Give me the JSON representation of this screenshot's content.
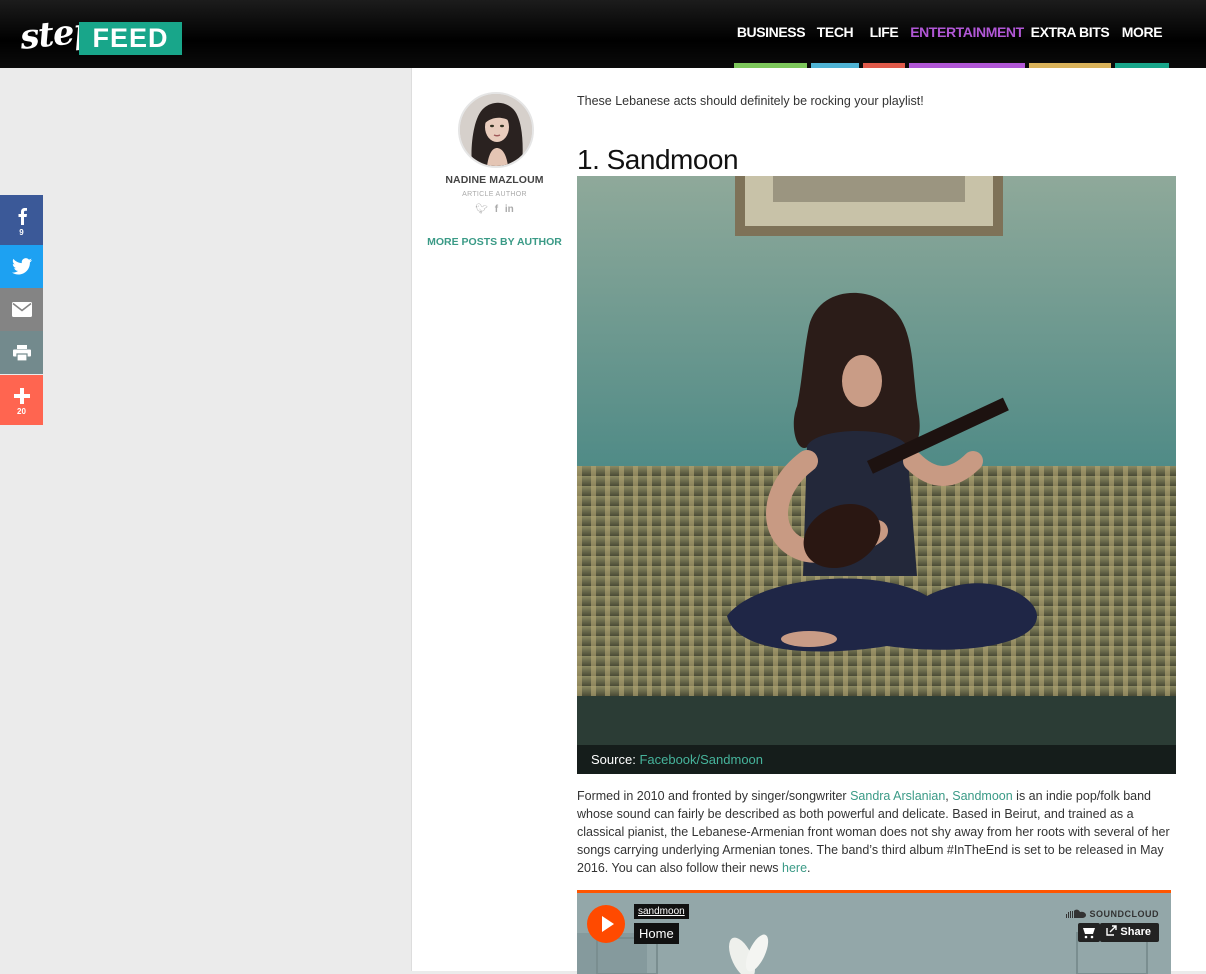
{
  "logo": {
    "step": "step",
    "feed": "FEED"
  },
  "nav": {
    "items": [
      {
        "label": "BUSINESS",
        "color": "#7dc75b"
      },
      {
        "label": "TECH",
        "color": "#4fb3d4"
      },
      {
        "label": "LIFE",
        "color": "#e05a4a"
      },
      {
        "label": "ENTERTAINMENT",
        "color": "#b157d6",
        "active": true
      },
      {
        "label": "EXTRA BITS",
        "color": "#d9b25a"
      },
      {
        "label": "MORE",
        "color": "#18a68a"
      }
    ]
  },
  "share": {
    "facebook": {
      "icon": "facebook-icon",
      "count": "9",
      "color": "#3b5998"
    },
    "twitter": {
      "icon": "twitter-icon",
      "color": "#1da1f2"
    },
    "email": {
      "icon": "email-icon",
      "color": "#848484"
    },
    "print": {
      "icon": "print-icon",
      "color": "#738a8d"
    },
    "more": {
      "icon": "plus-icon",
      "count": "20",
      "color": "#ff6550"
    }
  },
  "author": {
    "name": "NADINE MAZLOUM",
    "role": "ARTICLE AUTHOR",
    "more_posts": "MORE POSTS BY AUTHOR"
  },
  "article": {
    "intro": "These Lebanese acts should definitely be rocking your playlist!",
    "section_title": "1. Sandmoon",
    "caption_label": "Source:",
    "caption_link": "Facebook/Sandmoon",
    "body": {
      "p1": "Formed in 2010 and fronted by singer/songwriter ",
      "link1": "Sandra Arslanian",
      "p2": ", ",
      "link2": "Sandmoon",
      "p3": " is an indie pop/folk band whose sound can fairly be described as both powerful and delicate. Based in Beirut, and trained as a classical pianist, the Lebanese-Armenian front woman does not shy away from her roots with several of her songs carrying underlying Armenian tones. The band’s third album #InTheEnd is set to be released in May 2016. You can also follow their news ",
      "link3": "here",
      "p4": "."
    }
  },
  "soundcloud": {
    "user": "sandmoon",
    "title": "Home",
    "logo": "SOUNDCLOUD",
    "share_label": "Share"
  }
}
